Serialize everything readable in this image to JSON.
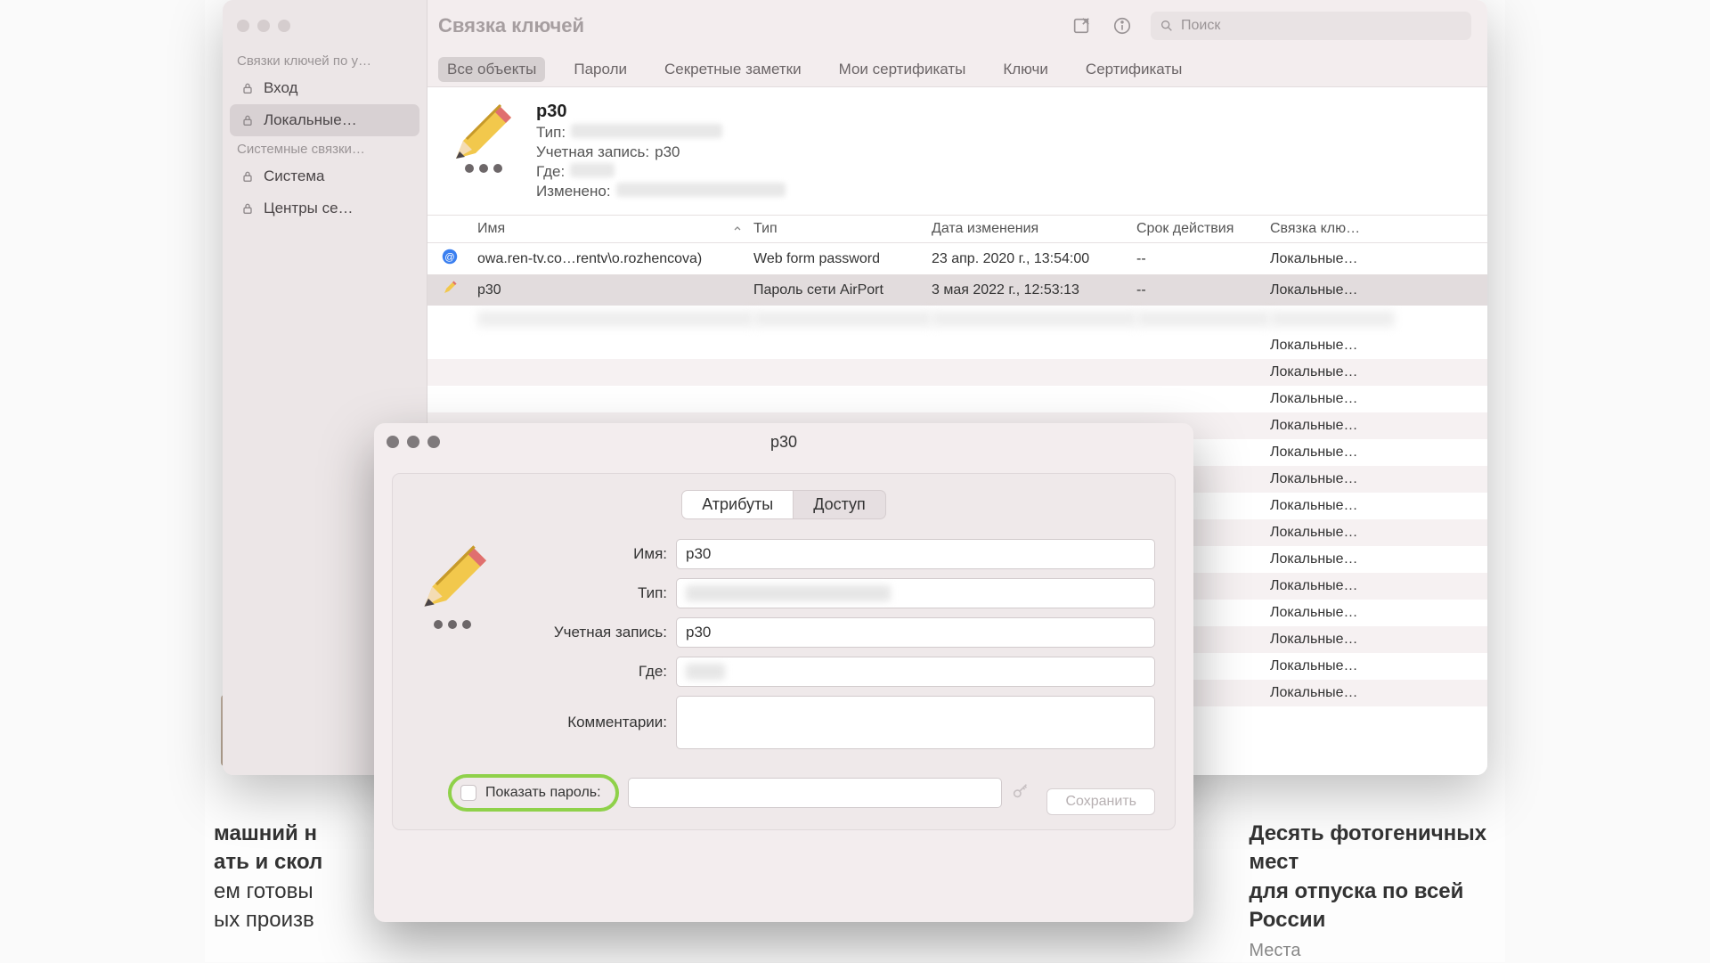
{
  "window": {
    "title": "Связка ключей",
    "search_placeholder": "Поиск"
  },
  "sidebar": {
    "groups": [
      {
        "header": "Связки ключей по у…",
        "items": [
          {
            "label": "Вход"
          },
          {
            "label": "Локальные…",
            "selected": true
          }
        ]
      },
      {
        "header": "Системные связки…",
        "items": [
          {
            "label": "Система"
          },
          {
            "label": "Центры се…"
          }
        ]
      }
    ]
  },
  "tabs": [
    "Все объекты",
    "Пароли",
    "Секретные заметки",
    "Мои сертификаты",
    "Ключи",
    "Сертификаты"
  ],
  "info": {
    "title": "p30",
    "type_label": "Тип:",
    "account_label": "Учетная запись:",
    "account_value": "p30",
    "where_label": "Где:",
    "modified_label": "Изменено:"
  },
  "table": {
    "headers": {
      "name": "Имя",
      "type": "Тип",
      "modified": "Дата изменения",
      "expires": "Срок действия",
      "keychain": "Связка клю…"
    },
    "rows": [
      {
        "icon": "at",
        "name": "owa.ren-tv.co…rentv\\o.rozhencova)",
        "type": "Web form password",
        "modified": "23 апр. 2020 г., 13:54:00",
        "expires": "--",
        "keychain": "Локальные…"
      },
      {
        "icon": "pencil",
        "name": "p30",
        "type": "Пароль сети AirPort",
        "modified": "3 мая 2022 г., 12:53:13",
        "expires": "--",
        "keychain": "Локальные…",
        "selected": true
      }
    ],
    "filler_keychain": "Локальные…"
  },
  "dialog": {
    "title": "p30",
    "tabs": {
      "attributes": "Атрибуты",
      "access": "Доступ"
    },
    "labels": {
      "name": "Имя:",
      "type": "Тип:",
      "account": "Учетная запись:",
      "where": "Где:",
      "comments": "Комментарии:",
      "show_password": "Показать пароль:"
    },
    "values": {
      "name": "p30",
      "account": "p30"
    },
    "save": "Сохранить"
  },
  "articles": {
    "left": {
      "l1": "машний н",
      "l2": "ать и скол",
      "l3": "ем готовы",
      "l4": "ых произв"
    },
    "right": {
      "l1": "Десять фотогеничных мест",
      "l2": "для отпуска по всей России",
      "cat": "Места"
    }
  }
}
